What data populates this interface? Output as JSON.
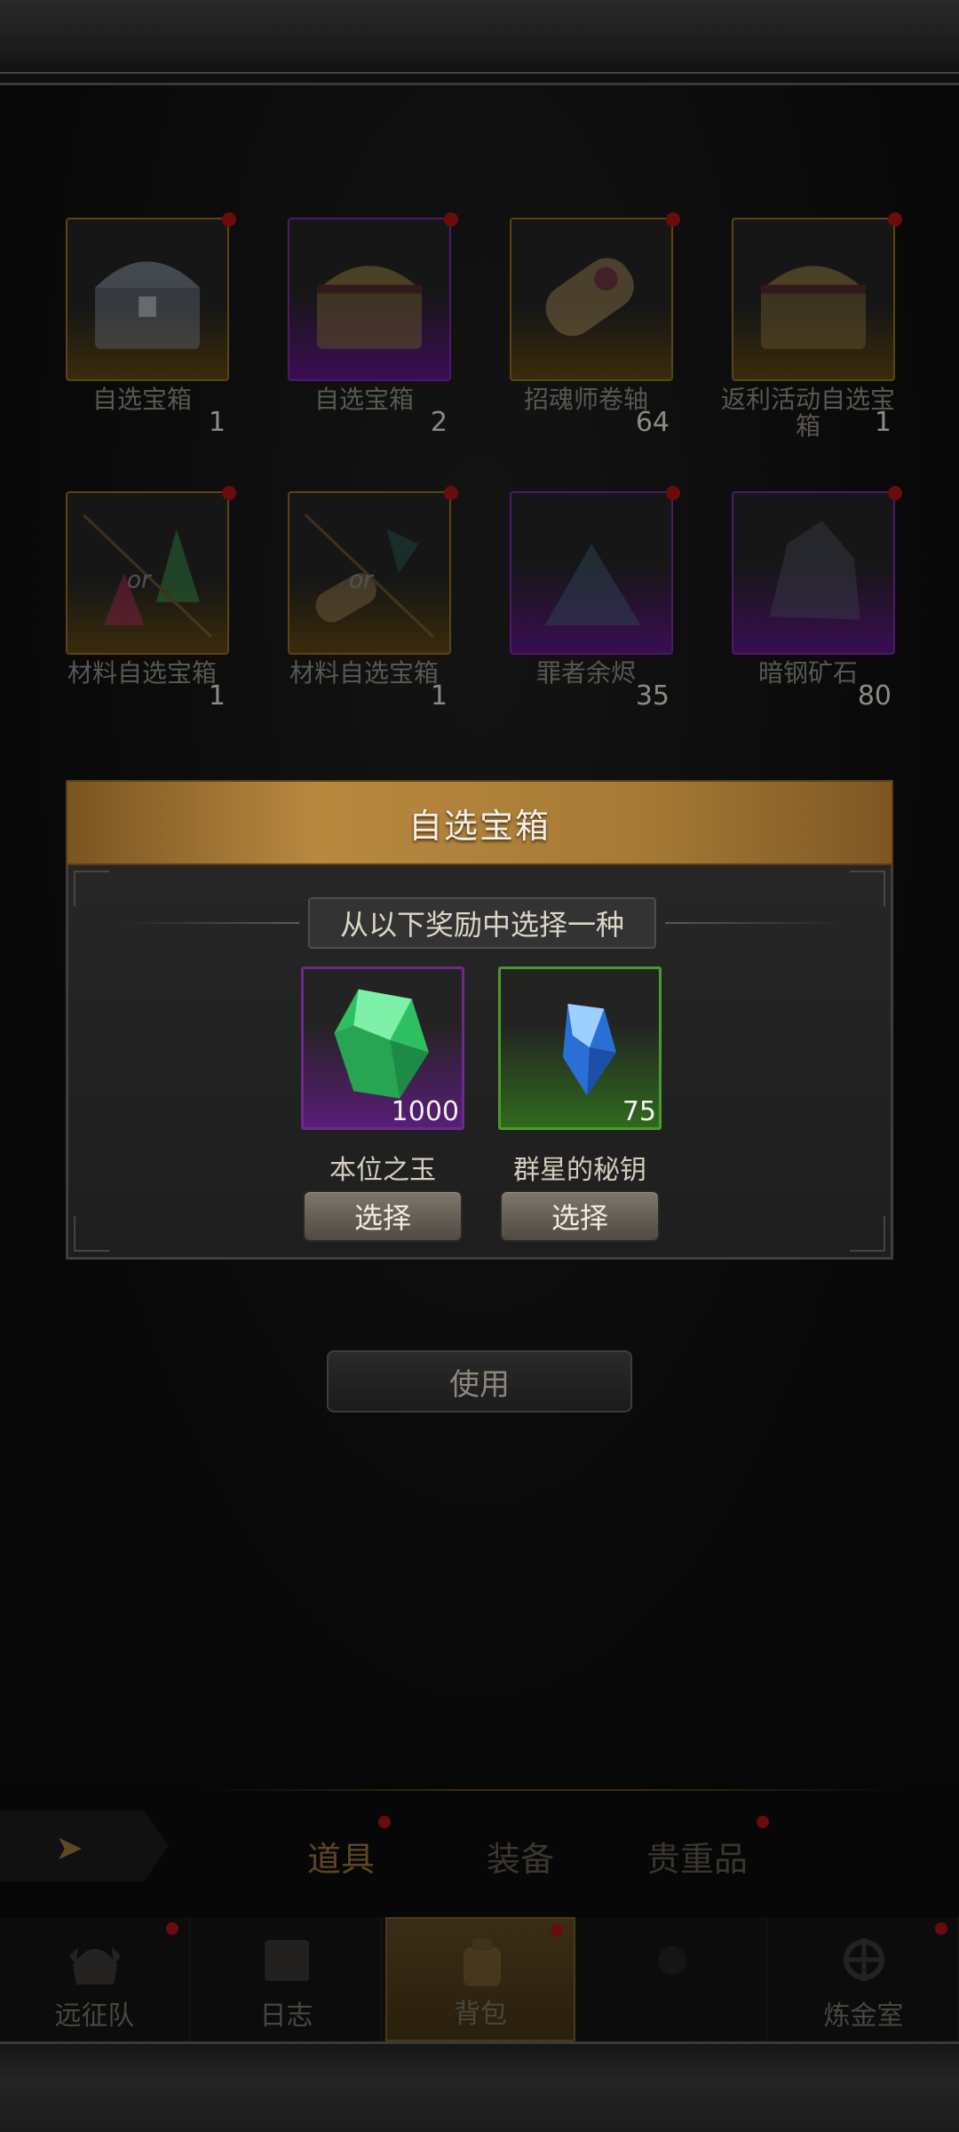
{
  "inventory": {
    "items": [
      {
        "name": "自选宝箱",
        "qty": "1",
        "rarity": "gold",
        "icon": "silver-chest-icon"
      },
      {
        "name": "自选宝箱",
        "qty": "2",
        "rarity": "purple",
        "icon": "wooden-chest-icon"
      },
      {
        "name": "招魂师卷轴",
        "qty": "64",
        "rarity": "gold",
        "icon": "scroll-icon"
      },
      {
        "name": "返利活动自选宝箱",
        "qty": "1",
        "rarity": "gold",
        "icon": "wooden-chest-icon"
      },
      {
        "name": "材料自选宝箱",
        "qty": "1",
        "rarity": "gold",
        "icon": "crystal-choice-icon",
        "or_label": "or"
      },
      {
        "name": "材料自选宝箱",
        "qty": "1",
        "rarity": "gold",
        "icon": "scroll-choice-icon",
        "or_label": "or"
      },
      {
        "name": "罪者余烬",
        "qty": "35",
        "rarity": "purple",
        "icon": "ember-icon"
      },
      {
        "name": "暗钢矿石",
        "qty": "80",
        "rarity": "purple",
        "icon": "ore-icon"
      }
    ]
  },
  "dialog": {
    "title": "自选宝箱",
    "subtitle": "从以下奖励中选择一种",
    "rewards": [
      {
        "name": "本位之玉",
        "qty": "1000",
        "rarity": "purple",
        "icon": "green-gem-icon",
        "button": "选择"
      },
      {
        "name": "群星的秘钥",
        "qty": "75",
        "rarity": "green",
        "icon": "blue-crystal-icon",
        "button": "选择"
      }
    ]
  },
  "use_button": "使用",
  "tabs": {
    "back_icon": "back-arrow-icon",
    "items": [
      {
        "label": "道具",
        "active": true,
        "badge": true
      },
      {
        "label": "装备",
        "active": false,
        "badge": false
      },
      {
        "label": "贵重品",
        "active": false,
        "badge": true
      }
    ]
  },
  "nav": {
    "items": [
      {
        "label": "远征队",
        "icon": "helmet-icon",
        "active": false,
        "badge": true
      },
      {
        "label": "日志",
        "icon": "journal-icon",
        "active": false,
        "badge": false
      },
      {
        "label": "背包",
        "icon": "backpack-icon",
        "active": true,
        "badge": true
      },
      {
        "label": "",
        "icon": "unknown-icon",
        "active": false,
        "badge": false
      },
      {
        "label": "炼金室",
        "icon": "alchemy-icon",
        "active": false,
        "badge": true
      }
    ]
  },
  "colors": {
    "dialog_header": "#b8883f",
    "purple_rarity": "#6b2a8c",
    "green_rarity": "#4c9a2a",
    "badge_red": "#6b0c0c"
  }
}
